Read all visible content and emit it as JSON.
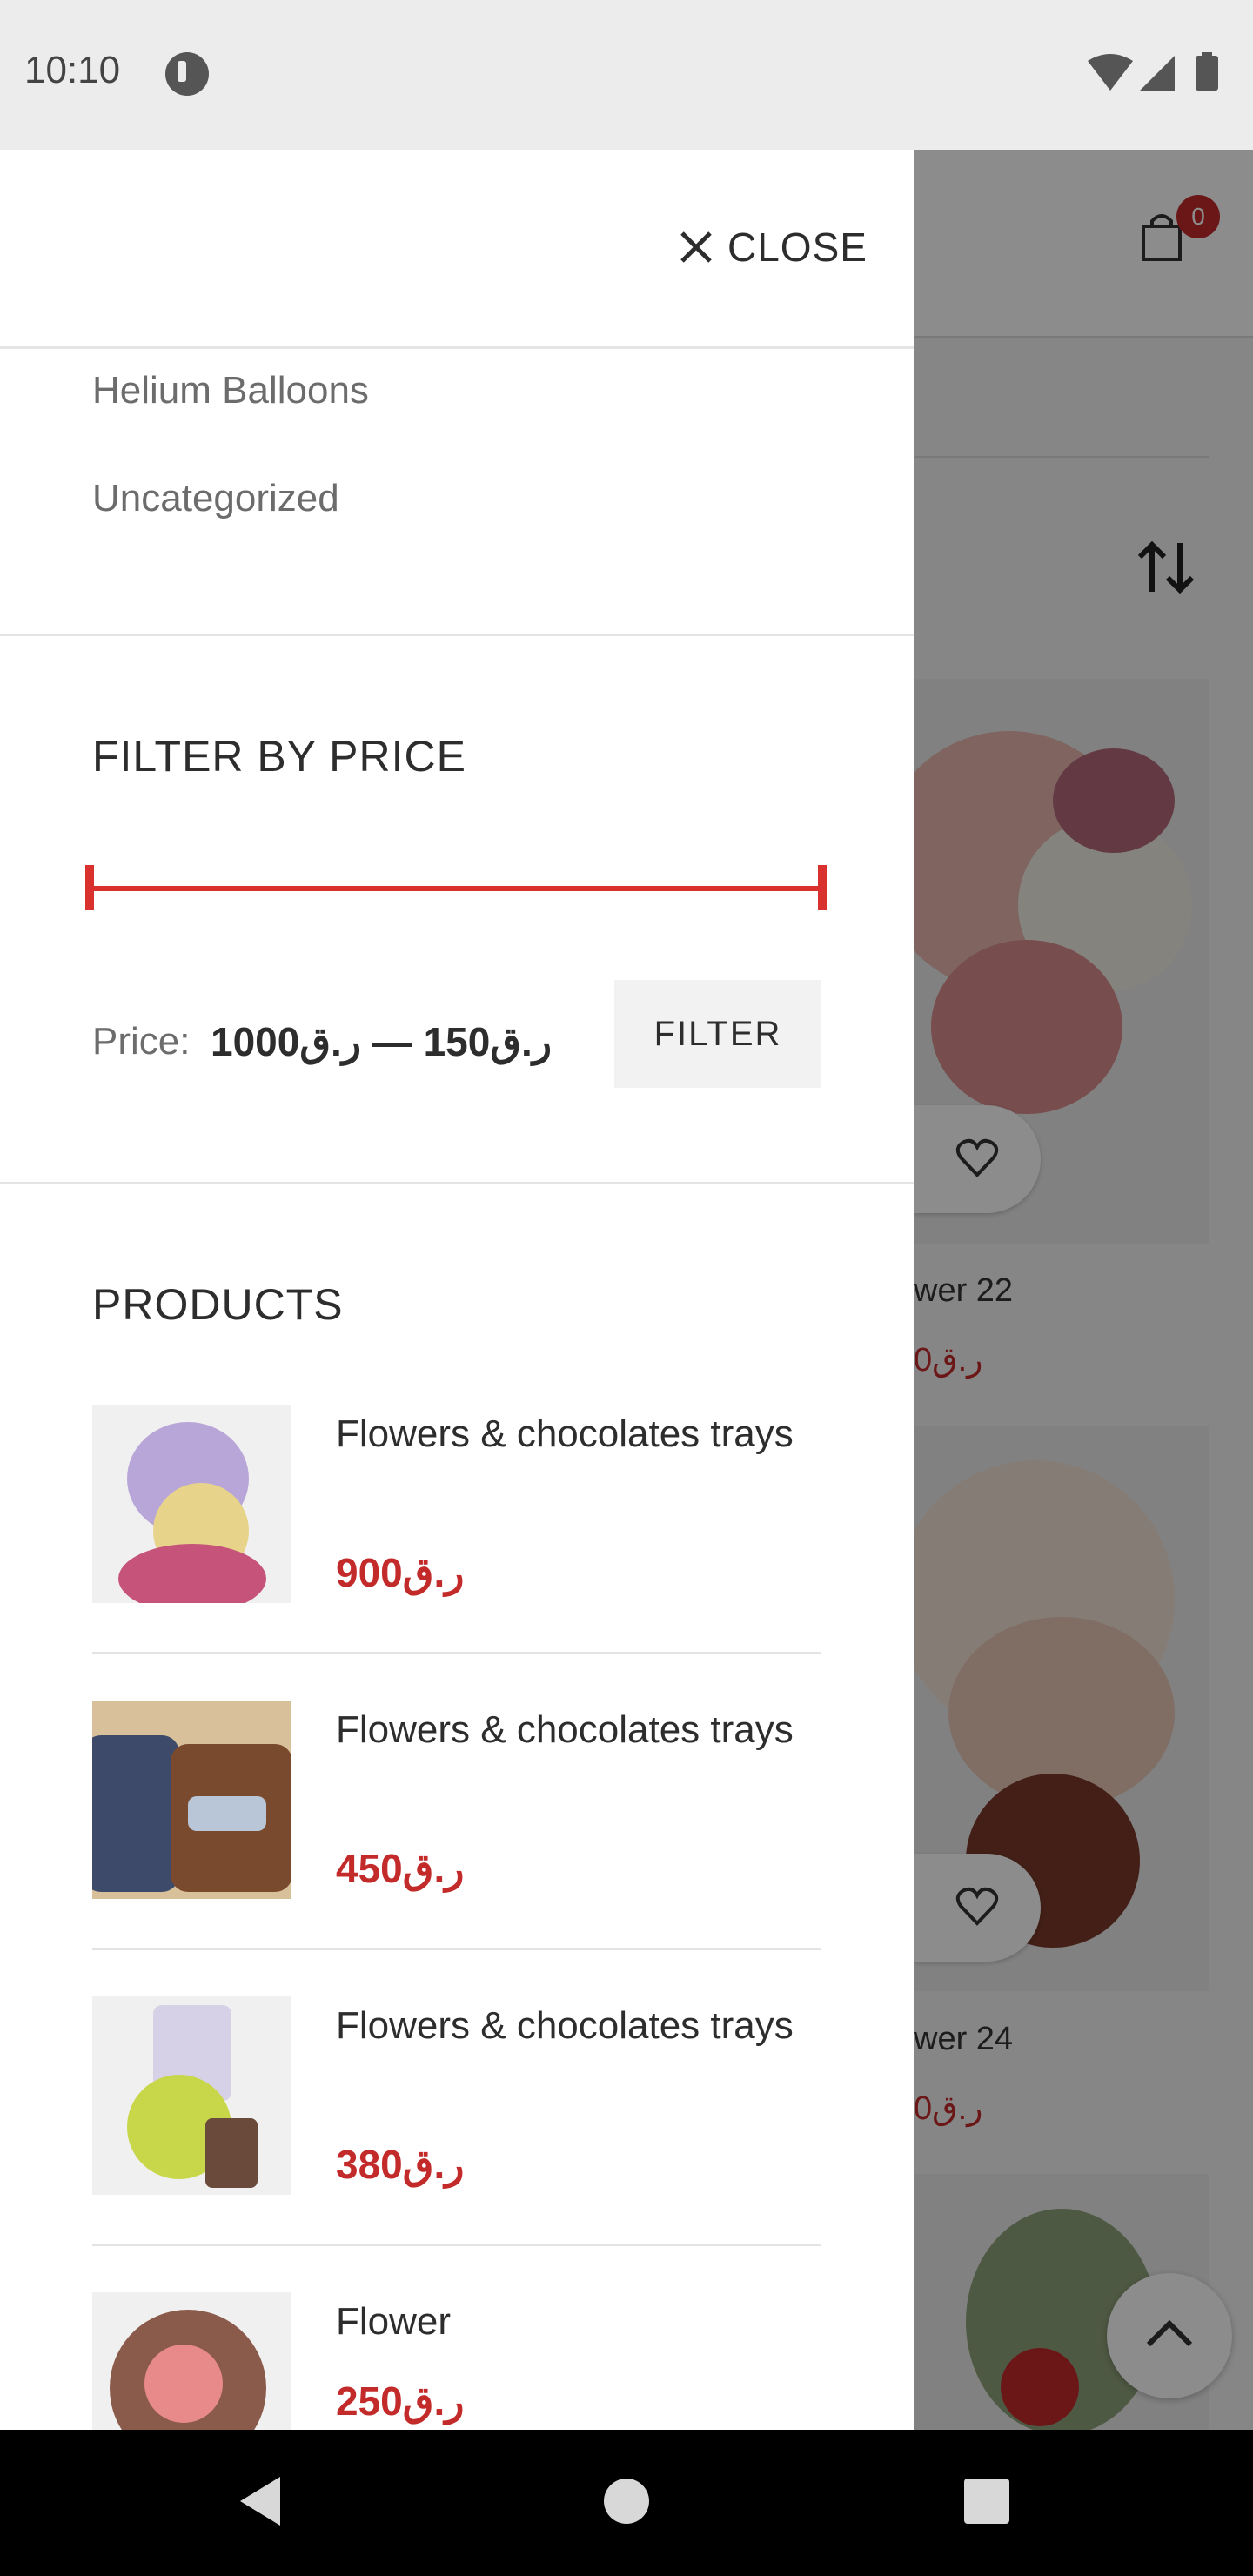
{
  "status_bar": {
    "time": "10:10"
  },
  "background_page": {
    "cart_count": "0",
    "products": [
      {
        "name": "wer 22",
        "price": "0ر.ق"
      },
      {
        "name": "wer 24",
        "price": "0ر.ق"
      }
    ]
  },
  "drawer": {
    "close_label": "CLOSE",
    "categories": [
      "Helium Balloons",
      "Uncategorized"
    ],
    "price_filter": {
      "title": "FILTER BY PRICE",
      "price_label": "Price:",
      "range_text": "ر.ق150 — ر.ق1000",
      "filter_button": "FILTER"
    },
    "products_widget": {
      "title": "PRODUCTS",
      "items": [
        {
          "name": "Flowers & chocolates trays",
          "price": "900ر.ق"
        },
        {
          "name": "Flowers & chocolates trays",
          "price": "450ر.ق"
        },
        {
          "name": "Flowers & chocolates trays",
          "price": "380ر.ق"
        },
        {
          "name": "Flower",
          "price": "250ر.ق"
        }
      ]
    }
  },
  "colors": {
    "accent": "#d8312e",
    "price": "#c32a2a"
  }
}
